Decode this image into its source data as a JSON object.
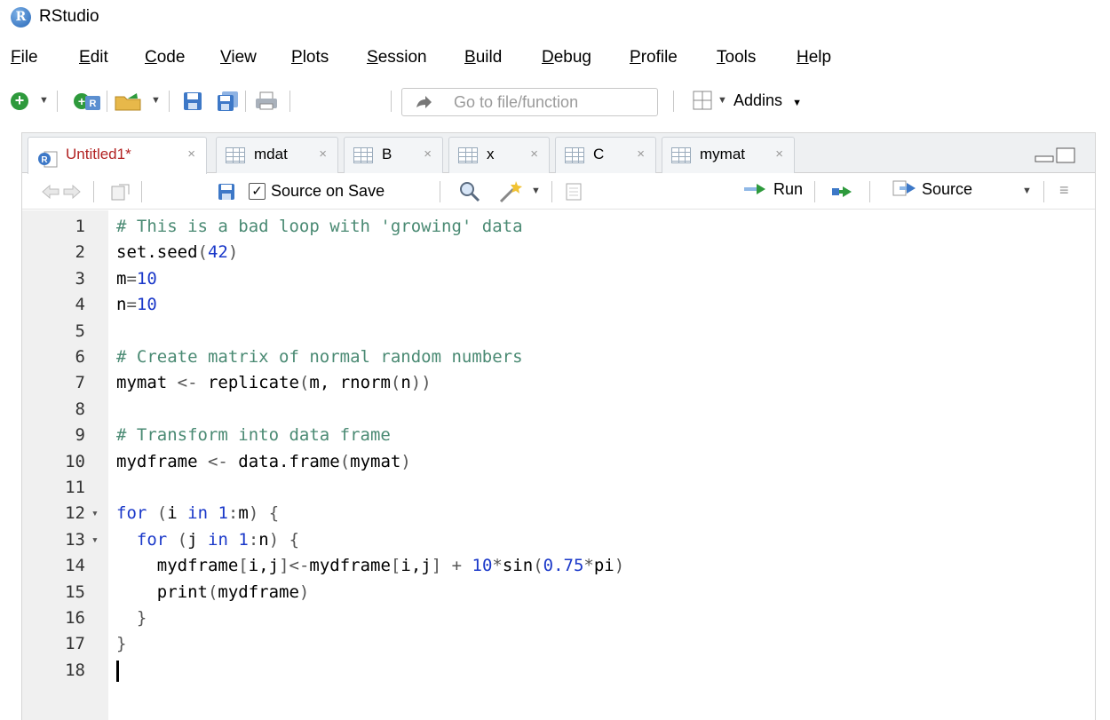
{
  "window": {
    "title": "RStudio",
    "logo_letter": "R"
  },
  "menu": [
    {
      "pre": "",
      "u": "F",
      "post": "ile"
    },
    {
      "pre": "",
      "u": "E",
      "post": "dit"
    },
    {
      "pre": "",
      "u": "C",
      "post": "ode"
    },
    {
      "pre": "",
      "u": "V",
      "post": "iew"
    },
    {
      "pre": "",
      "u": "P",
      "post": "lots"
    },
    {
      "pre": "",
      "u": "S",
      "post": "ession"
    },
    {
      "pre": "",
      "u": "B",
      "post": "uild"
    },
    {
      "pre": "",
      "u": "D",
      "post": "ebug"
    },
    {
      "pre": "",
      "u": "P",
      "post": "rofile"
    },
    {
      "pre": "",
      "u": "T",
      "post": "ools"
    },
    {
      "pre": "",
      "u": "H",
      "post": "elp"
    }
  ],
  "toolbar": {
    "goto_placeholder": "Go to file/function",
    "addins_label": "Addins"
  },
  "tabs": [
    {
      "label": "Untitled1*",
      "icon": "r-script-icon",
      "active": true
    },
    {
      "label": "mdat",
      "icon": "data-grid-icon",
      "active": false
    },
    {
      "label": "B",
      "icon": "data-grid-icon",
      "active": false
    },
    {
      "label": "x",
      "icon": "data-grid-icon",
      "active": false
    },
    {
      "label": "C",
      "icon": "data-grid-icon",
      "active": false
    },
    {
      "label": "mymat",
      "icon": "data-grid-icon",
      "active": false
    }
  ],
  "tab_close_glyph": "×",
  "editor_toolbar": {
    "source_on_save_label": "Source on Save",
    "source_on_save_checked": true,
    "run_label": "Run",
    "source_label": "Source"
  },
  "code_lines": [
    {
      "n": "1",
      "fold": "",
      "text": "# This is a bad loop with 'growing' data"
    },
    {
      "n": "2",
      "fold": "",
      "text": "set.seed(42)"
    },
    {
      "n": "3",
      "fold": "",
      "text": "m=10"
    },
    {
      "n": "4",
      "fold": "",
      "text": "n=10"
    },
    {
      "n": "5",
      "fold": "",
      "text": ""
    },
    {
      "n": "6",
      "fold": "",
      "text": "# Create matrix of normal random numbers"
    },
    {
      "n": "7",
      "fold": "",
      "text": "mymat <- replicate(m, rnorm(n))"
    },
    {
      "n": "8",
      "fold": "",
      "text": ""
    },
    {
      "n": "9",
      "fold": "",
      "text": "# Transform into data frame"
    },
    {
      "n": "10",
      "fold": "",
      "text": "mydframe <- data.frame(mymat)"
    },
    {
      "n": "11",
      "fold": "",
      "text": ""
    },
    {
      "n": "12",
      "fold": "▾",
      "text": "for (i in 1:m) {"
    },
    {
      "n": "13",
      "fold": "▾",
      "text": "  for (j in 1:n) {"
    },
    {
      "n": "14",
      "fold": "",
      "text": "    mydframe[i,j]<-mydframe[i,j] + 10*sin(0.75*pi)"
    },
    {
      "n": "15",
      "fold": "",
      "text": "    print(mydframe)"
    },
    {
      "n": "16",
      "fold": "",
      "text": "  }"
    },
    {
      "n": "17",
      "fold": "",
      "text": "}"
    },
    {
      "n": "18",
      "fold": "",
      "text": ""
    }
  ],
  "colors": {
    "comment": "#4a8a73",
    "number": "#1a38c9",
    "keyword": "#1a38c9",
    "active_tab_text": "#b22222",
    "gutter_bg": "#f0f0f0"
  }
}
